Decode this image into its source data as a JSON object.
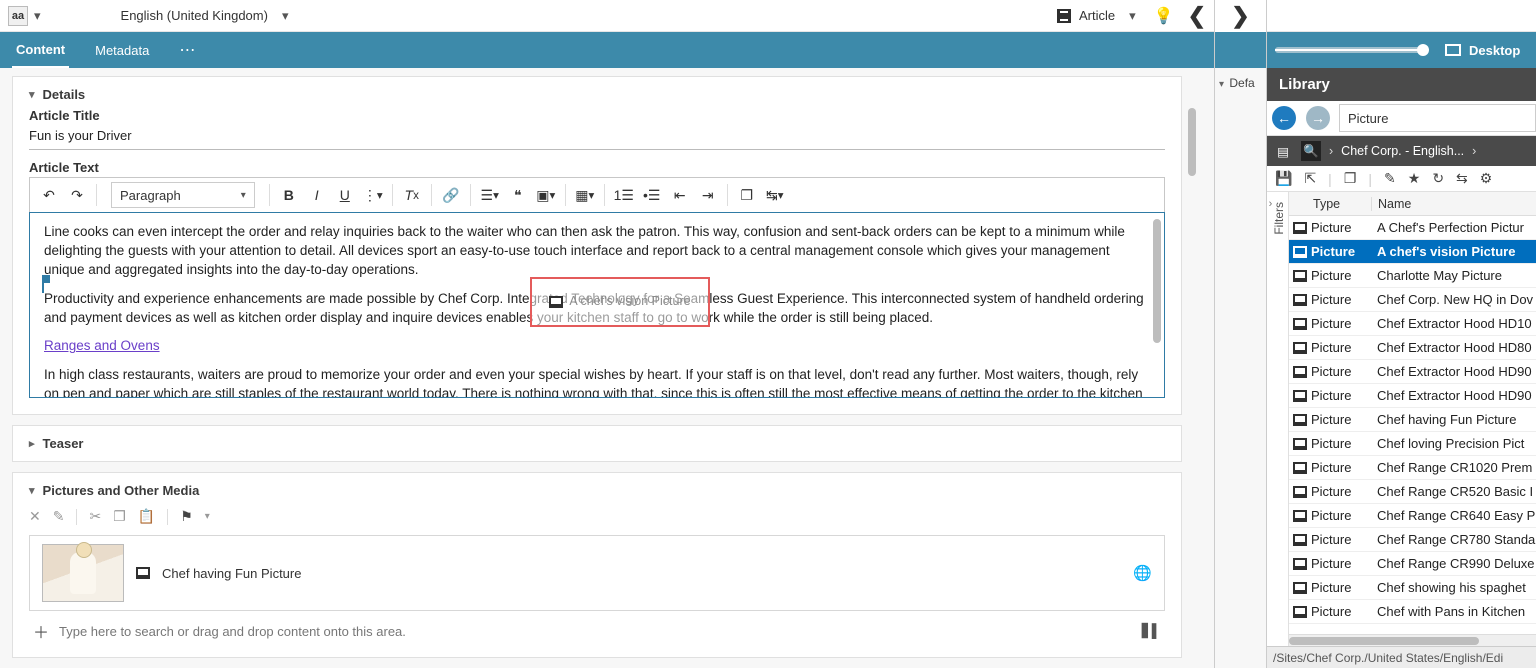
{
  "topbar": {
    "logo_text": "aa",
    "language": "English (United Kingdom)",
    "doc_type": "Article"
  },
  "tabs": {
    "content": "Content",
    "metadata": "Metadata"
  },
  "details": {
    "head": "Details",
    "title_label": "Article Title",
    "title_value": "Fun is your Driver",
    "text_label": "Article Text",
    "paragraph_select": "Paragraph",
    "drop_ghost_label": "A chef's vision Picture",
    "body_p1": "Line cooks can even intercept the order and relay inquiries back to the waiter who can then ask the patron. This way, confusion and sent-back orders can be kept to a minimum while delighting the guests with your attention to detail. All devices sport an easy-to-use touch interface and report back to a central management console which gives your management unique and aggregated insights into the day-to-day operations.",
    "body_p2": "Productivity and experience enhancements are made possible by Chef Corp. Integrated Technology for a Seamless Guest Experience. This interconnected system of handheld ordering and payment devices as well as kitchen order display and inquire devices enables your kitchen staff to go to work while the order is still being placed.",
    "body_link": "Ranges and Ovens",
    "body_p3": "In high class restaurants, waiters are proud to memorize your order and even your special wishes by heart. If your staff is on that level, don't read any further. Most waiters, though, rely on pen and paper which are still staples of the restaurant world today. There is nothing wrong with that, since this is often still the most effective means of getting the order to the kitchen and"
  },
  "teaser": {
    "head": "Teaser"
  },
  "pictures": {
    "head": "Pictures and Other Media",
    "row_label": "Chef having Fun Picture",
    "hint": "Type here to search or drag and drop content onto this area."
  },
  "mid": {
    "default": "Defa"
  },
  "rightbar": {
    "desktop": "Desktop"
  },
  "library": {
    "title": "Library",
    "search_value": "Picture",
    "crumb": "Chef Corp. - English...",
    "col_type": "Type",
    "col_name": "Name",
    "filters": "Filters",
    "footer": "/Sites/Chef Corp./United States/English/Edi",
    "rows": [
      {
        "type": "Picture",
        "name": "A Chef's Perfection Pictur",
        "selected": false
      },
      {
        "type": "Picture",
        "name": "A chef's vision Picture",
        "selected": true
      },
      {
        "type": "Picture",
        "name": "Charlotte May Picture",
        "selected": false
      },
      {
        "type": "Picture",
        "name": "Chef Corp. New HQ in Dov",
        "selected": false
      },
      {
        "type": "Picture",
        "name": "Chef Extractor Hood HD10",
        "selected": false
      },
      {
        "type": "Picture",
        "name": "Chef Extractor Hood HD80",
        "selected": false
      },
      {
        "type": "Picture",
        "name": "Chef Extractor Hood HD90",
        "selected": false
      },
      {
        "type": "Picture",
        "name": "Chef Extractor Hood HD90",
        "selected": false
      },
      {
        "type": "Picture",
        "name": "Chef having Fun Picture",
        "selected": false
      },
      {
        "type": "Picture",
        "name": "Chef loving Precision Pict",
        "selected": false
      },
      {
        "type": "Picture",
        "name": "Chef Range CR1020 Prem",
        "selected": false
      },
      {
        "type": "Picture",
        "name": "Chef Range CR520 Basic I",
        "selected": false
      },
      {
        "type": "Picture",
        "name": "Chef Range CR640 Easy P",
        "selected": false
      },
      {
        "type": "Picture",
        "name": "Chef Range CR780 Standa",
        "selected": false
      },
      {
        "type": "Picture",
        "name": "Chef Range CR990 Deluxe",
        "selected": false
      },
      {
        "type": "Picture",
        "name": "Chef showing his spaghet",
        "selected": false
      },
      {
        "type": "Picture",
        "name": "Chef with Pans in Kitchen",
        "selected": false
      }
    ]
  }
}
